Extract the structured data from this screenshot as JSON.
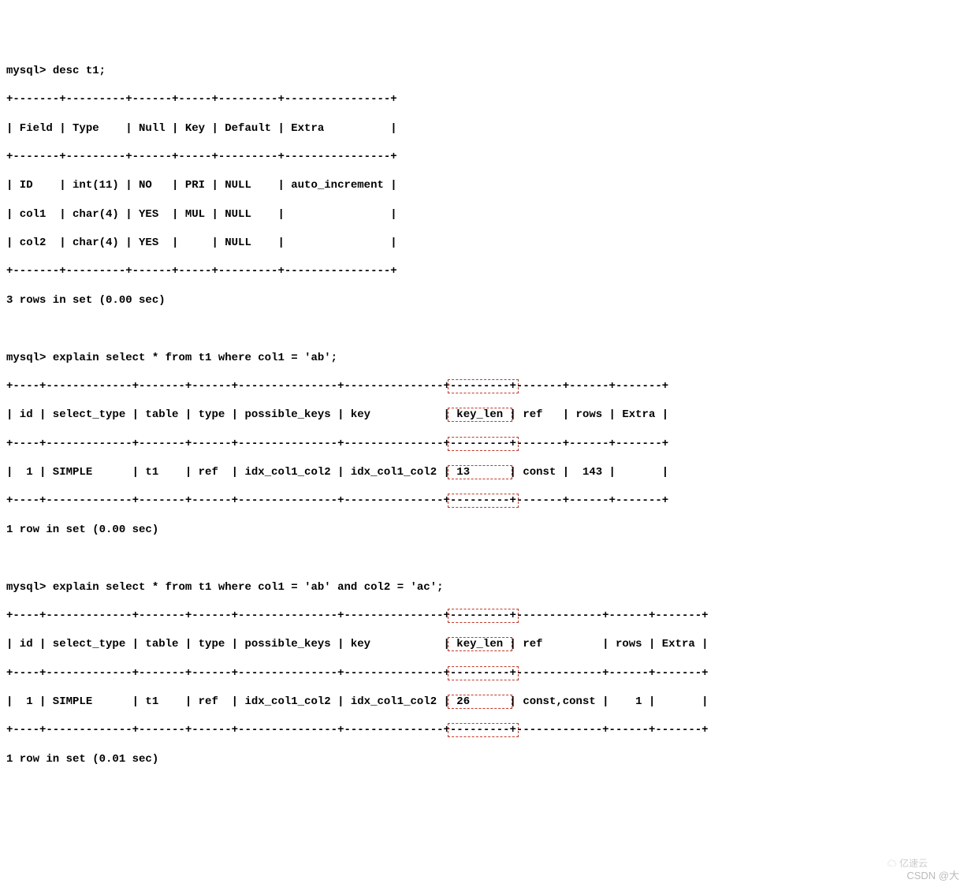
{
  "prompt": "mysql>",
  "cmd1": "desc t1;",
  "desc_border": "+-------+---------+------+-----+---------+----------------+",
  "desc_header": "| Field | Type    | Null | Key | Default | Extra          |",
  "desc_rows": [
    "| ID    | int(11) | NO   | PRI | NULL    | auto_increment |",
    "| col1  | char(4) | YES  | MUL | NULL    |                |",
    "| col2  | char(4) | YES  |     | NULL    |                |"
  ],
  "desc_footer": "3 rows in set (0.00 sec)",
  "cmd2": "explain select * from t1 where col1 = 'ab';",
  "exp1_border_left": "+----+-------------+-------+------+---------------+---------------+",
  "exp1_border_keylen": "---------+",
  "exp1_border_right": "-------+------+-------+",
  "exp1_header_left": "| id | select_type | table | type | possible_keys | key           |",
  "exp1_header_keylen": " key_len ",
  "exp1_header_right": "| ref   | rows | Extra |",
  "exp1_row_left": "|  1 | SIMPLE      | t1    | ref  | idx_col1_col2 | idx_col1_col2 |",
  "exp1_row_keylen": " 13      ",
  "exp1_row_right": "| const |  143 |       |",
  "exp1_footer": "1 row in set (0.00 sec)",
  "cmd3": "explain select * from t1 where col1 = 'ab' and col2 = 'ac';",
  "exp2_border_left": "+----+-------------+-------+------+---------------+---------------+",
  "exp2_border_keylen": "---------+",
  "exp2_border_right": "-------------+------+-------+",
  "exp2_header_left": "| id | select_type | table | type | possible_keys | key           |",
  "exp2_header_keylen": " key_len ",
  "exp2_header_right": "| ref         | rows | Extra |",
  "exp2_row_left": "|  1 | SIMPLE      | t1    | ref  | idx_col1_col2 | idx_col1_col2 |",
  "exp2_row_keylen": " 26      ",
  "exp2_row_right": "| const,const |    1 |       |",
  "exp2_footer": "1 row in set (0.01 sec)",
  "watermark": "CSDN @大",
  "logo_text": "亿速云",
  "chart_data": {
    "type": "table",
    "tables": [
      {
        "name": "desc t1",
        "columns": [
          "Field",
          "Type",
          "Null",
          "Key",
          "Default",
          "Extra"
        ],
        "rows": [
          [
            "ID",
            "int(11)",
            "NO",
            "PRI",
            "NULL",
            "auto_increment"
          ],
          [
            "col1",
            "char(4)",
            "YES",
            "MUL",
            "NULL",
            ""
          ],
          [
            "col2",
            "char(4)",
            "YES",
            "",
            "NULL",
            ""
          ]
        ],
        "footer": "3 rows in set (0.00 sec)"
      },
      {
        "name": "explain select * from t1 where col1 = 'ab'",
        "columns": [
          "id",
          "select_type",
          "table",
          "type",
          "possible_keys",
          "key",
          "key_len",
          "ref",
          "rows",
          "Extra"
        ],
        "rows": [
          [
            "1",
            "SIMPLE",
            "t1",
            "ref",
            "idx_col1_col2",
            "idx_col1_col2",
            "13",
            "const",
            "143",
            ""
          ]
        ],
        "footer": "1 row in set (0.00 sec)",
        "highlighted_column": "key_len"
      },
      {
        "name": "explain select * from t1 where col1 = 'ab' and col2 = 'ac'",
        "columns": [
          "id",
          "select_type",
          "table",
          "type",
          "possible_keys",
          "key",
          "key_len",
          "ref",
          "rows",
          "Extra"
        ],
        "rows": [
          [
            "1",
            "SIMPLE",
            "t1",
            "ref",
            "idx_col1_col2",
            "idx_col1_col2",
            "26",
            "const,const",
            "1",
            ""
          ]
        ],
        "footer": "1 row in set (0.01 sec)",
        "highlighted_column": "key_len"
      }
    ]
  }
}
